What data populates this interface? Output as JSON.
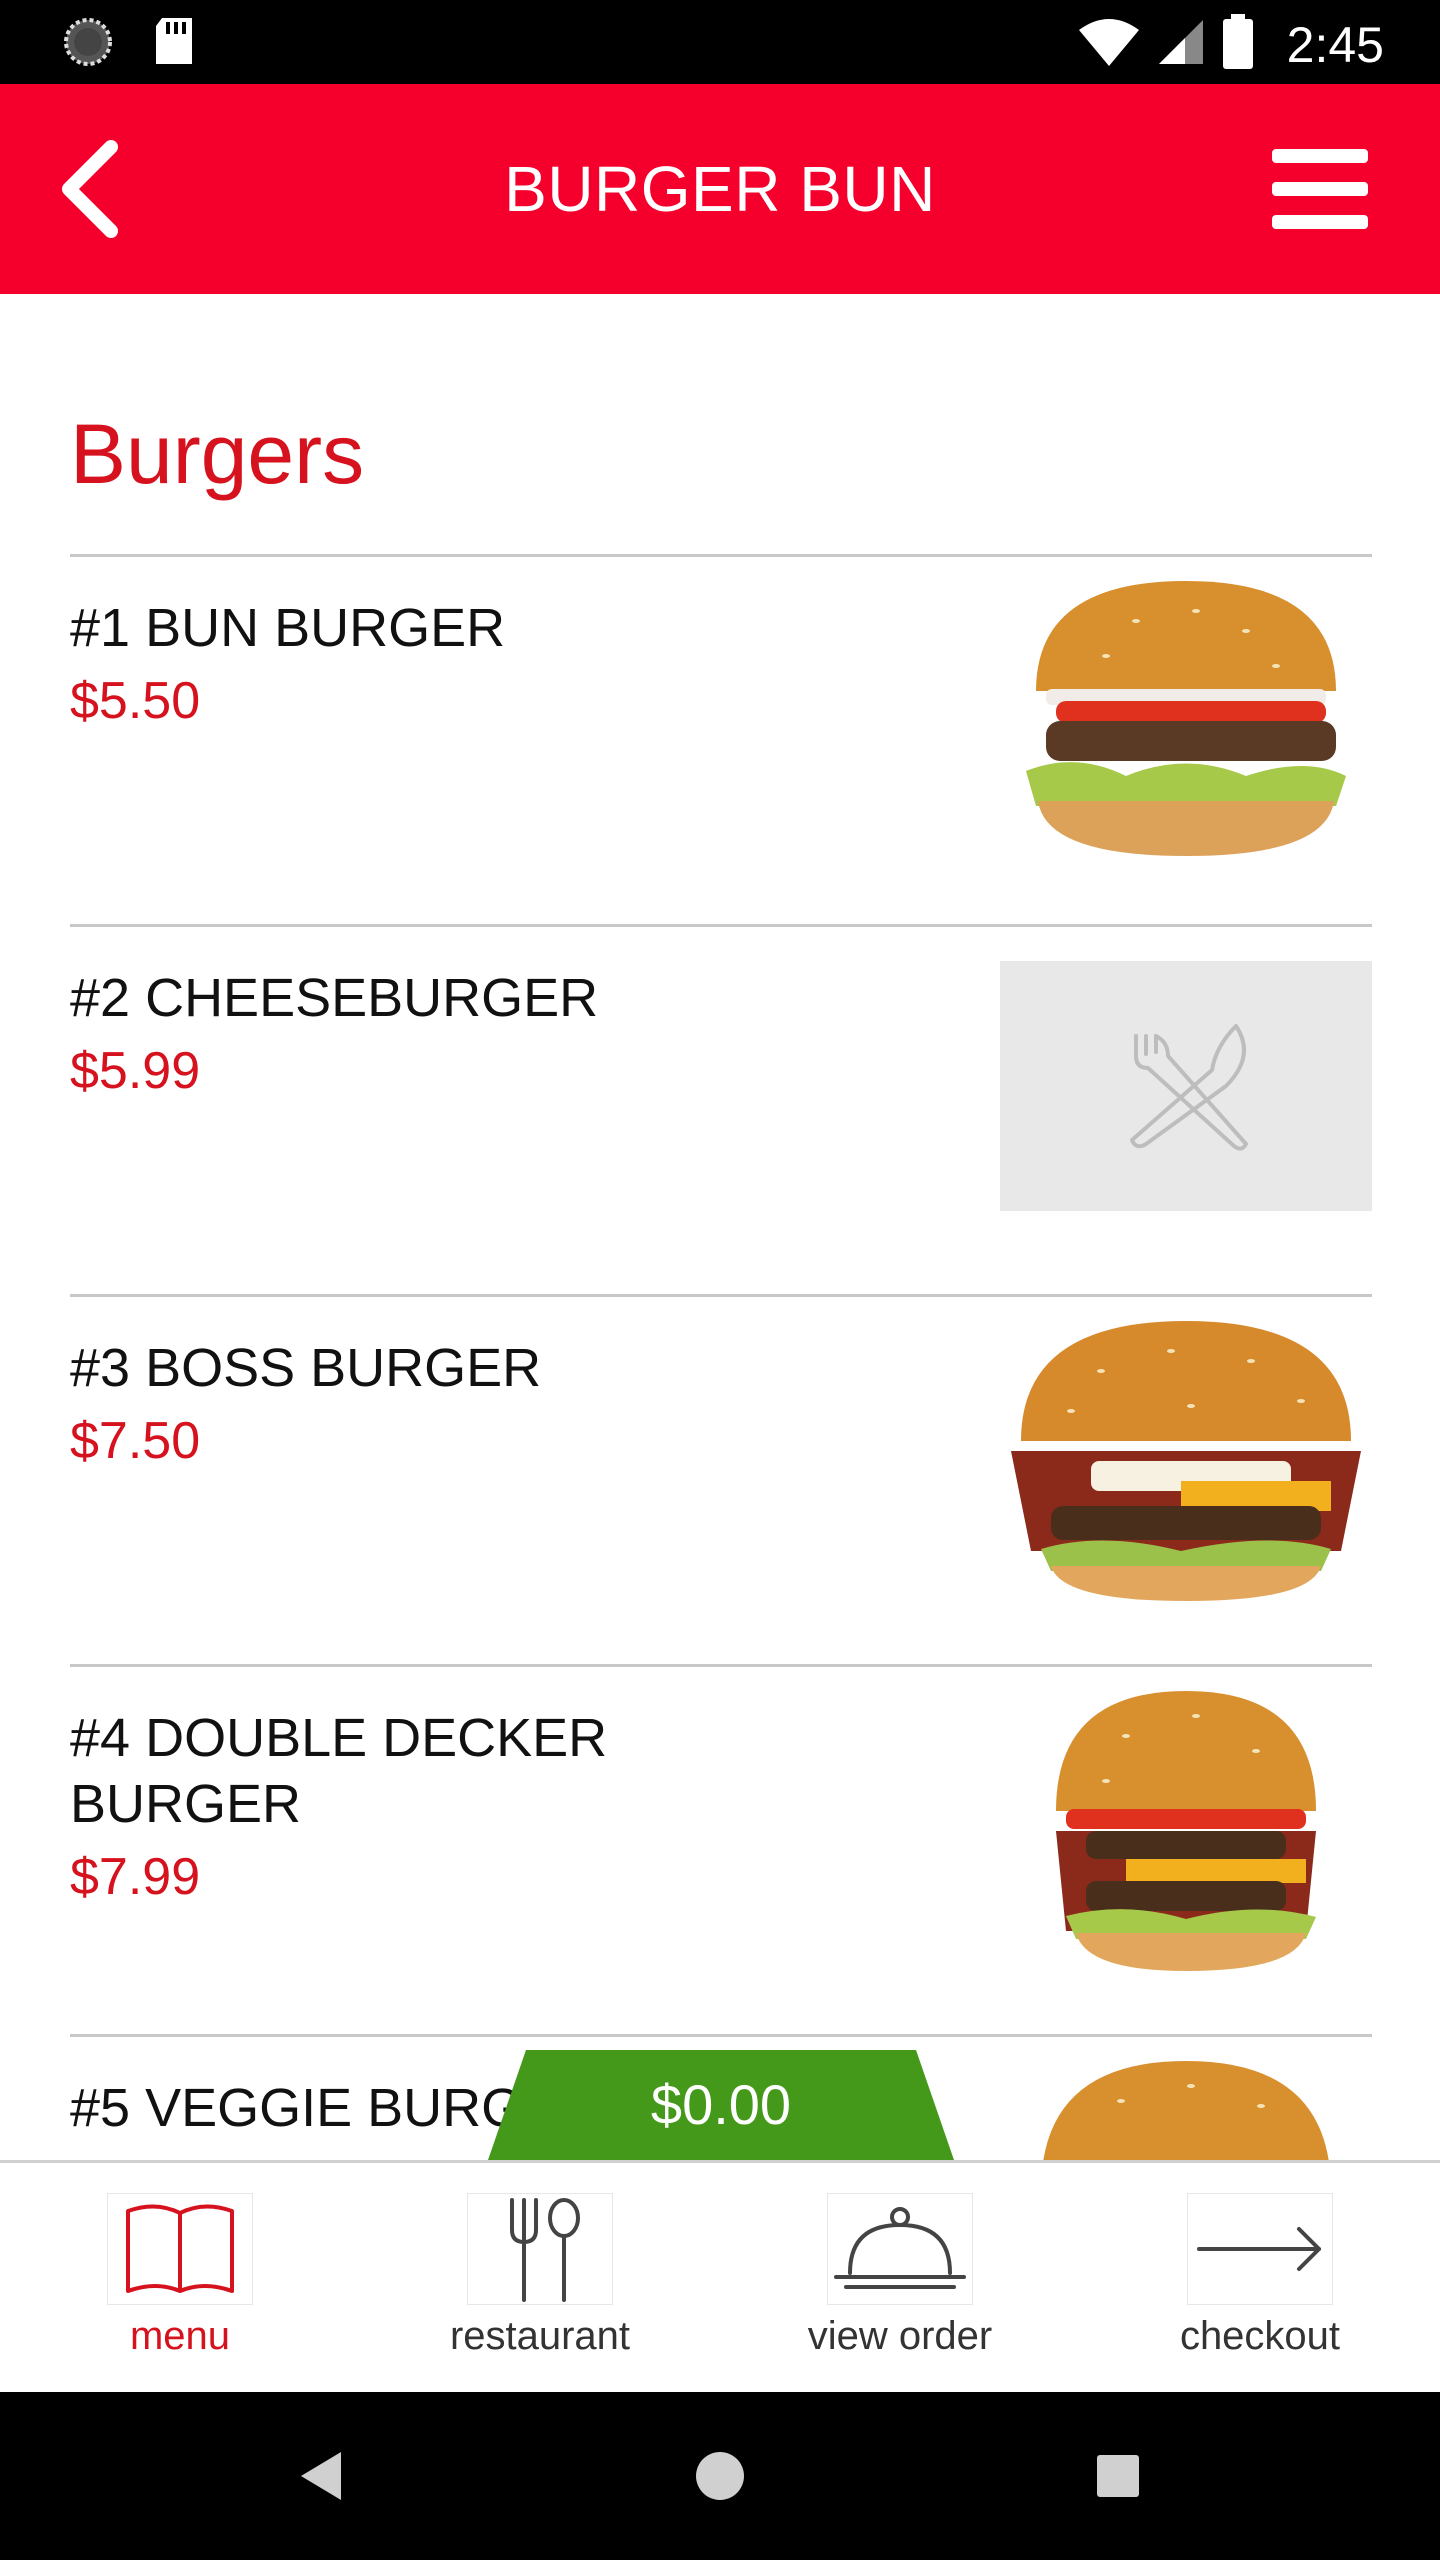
{
  "status_bar": {
    "time": "2:45",
    "icons": [
      "loading-icon",
      "sd-card-icon",
      "wifi-icon",
      "signal-icon",
      "battery-icon"
    ]
  },
  "app_bar": {
    "title": "BURGER BUN",
    "back_icon": "chevron-left-icon",
    "menu_icon": "hamburger-menu-icon",
    "color": "#f5002c"
  },
  "section": {
    "title": "Burgers"
  },
  "items": [
    {
      "name": "#1 BUN BURGER",
      "price": "$5.50",
      "image": "burger-photo"
    },
    {
      "name": "#2 CHEESEBURGER",
      "price": "$5.99",
      "image": "placeholder-utensils-icon"
    },
    {
      "name": "#3 BOSS BURGER",
      "price": "$7.50",
      "image": "burger-photo"
    },
    {
      "name": "#4 DOUBLE DECKER BURGER",
      "price": "$7.99",
      "image": "burger-photo"
    },
    {
      "name": "#5 VEGGIE BURGER",
      "price": "",
      "image": "burger-photo"
    }
  ],
  "cart": {
    "total": "$0.00",
    "color": "#44991a"
  },
  "bottom_nav": [
    {
      "label": "menu",
      "icon": "open-book-icon",
      "active": true
    },
    {
      "label": "restaurant",
      "icon": "fork-spoon-icon",
      "active": false
    },
    {
      "label": "view order",
      "icon": "food-cloche-icon",
      "active": false
    },
    {
      "label": "checkout",
      "icon": "arrow-right-icon",
      "active": false
    }
  ],
  "colors": {
    "accent_red": "#d5121d",
    "divider": "#c8c8c8"
  }
}
